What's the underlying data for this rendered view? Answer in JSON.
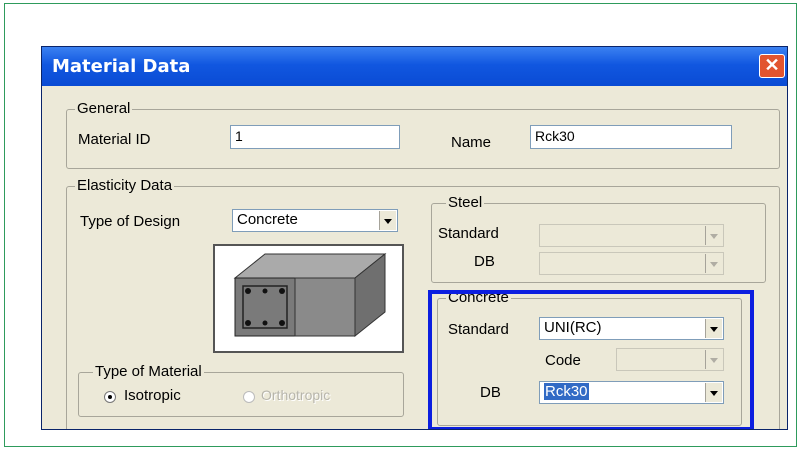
{
  "dialog": {
    "title": "Material Data",
    "close_glyph": "✕"
  },
  "general": {
    "label": "General",
    "material_id_label": "Material ID",
    "material_id_value": "1",
    "name_label": "Name",
    "name_value": "Rck30"
  },
  "elasticity": {
    "label": "Elasticity Data",
    "type_of_design_label": "Type of Design",
    "type_of_design_value": "Concrete"
  },
  "steel": {
    "label": "Steel",
    "standard_label": "Standard",
    "standard_value": "",
    "db_label": "DB",
    "db_value": ""
  },
  "concrete": {
    "label": "Concrete",
    "standard_label": "Standard",
    "standard_value": "UNI(RC)",
    "code_label": "Code",
    "code_value": "",
    "db_label": "DB",
    "db_value": "Rck30"
  },
  "material_type": {
    "label": "Type of Material",
    "isotropic": "Isotropic",
    "orthotropic": "Orthotropic",
    "selected": "Isotropic"
  },
  "icons": {
    "preview": "concrete-beam-section-icon"
  },
  "colors": {
    "highlight": "#0b1ee0",
    "titlebar": "#1157e0",
    "frame": "#2e9b5c"
  }
}
